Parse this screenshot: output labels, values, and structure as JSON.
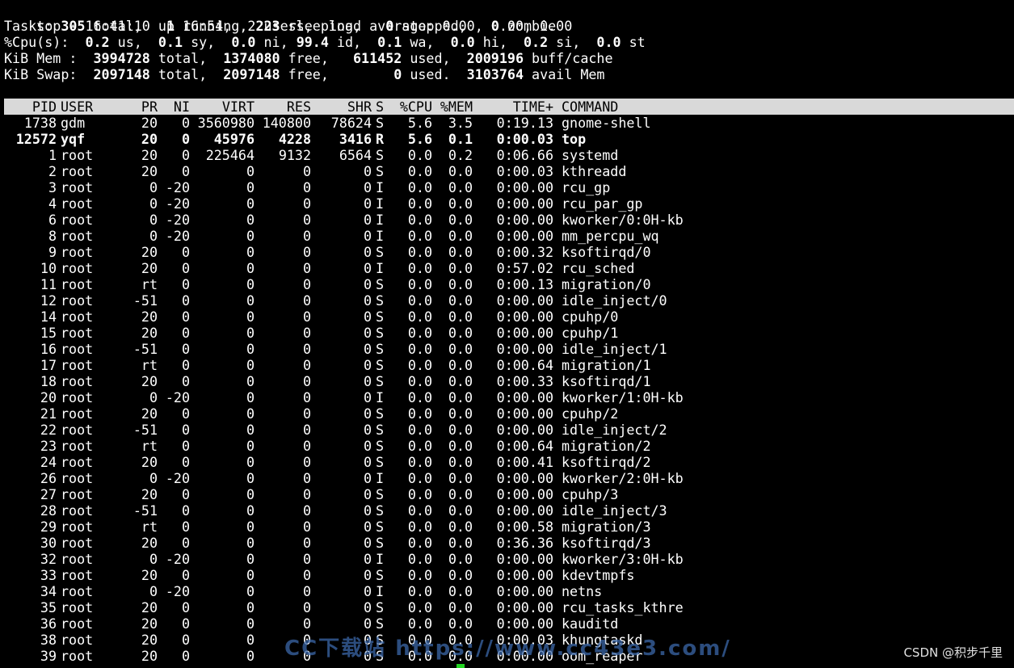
{
  "summary": {
    "line1": "top - 16:41:10 up 16:54,  2 users,  load average: 0.00, 0.00, 0.00",
    "tasks_label": "Tasks: ",
    "tasks_total": "305",
    "tasks_total_l": " total,   ",
    "tasks_running": "1",
    "tasks_running_l": " running, ",
    "tasks_sleeping": "223",
    "tasks_sleeping_l": " sleeping,   ",
    "tasks_stopped": "0",
    "tasks_stopped_l": " stopped,   ",
    "tasks_zombie": "0",
    "tasks_zombie_l": " zombie",
    "cpu_label": "%Cpu(s):  ",
    "cpu_us": "0.2",
    "cpu_us_l": " us,  ",
    "cpu_sy": "0.1",
    "cpu_sy_l": " sy,  ",
    "cpu_ni": "0.0",
    "cpu_ni_l": " ni, ",
    "cpu_id": "99.4",
    "cpu_id_l": " id,  ",
    "cpu_wa": "0.1",
    "cpu_wa_l": " wa,  ",
    "cpu_hi": "0.0",
    "cpu_hi_l": " hi,  ",
    "cpu_si": "0.2",
    "cpu_si_l": " si,  ",
    "cpu_st": "0.0",
    "cpu_st_l": " st",
    "mem_label": "KiB Mem :  ",
    "mem_total": "3994728",
    "mem_total_l": " total,  ",
    "mem_free": "1374080",
    "mem_free_l": " free,   ",
    "mem_used": "611452",
    "mem_used_l": " used,  ",
    "mem_buff": "2009196",
    "mem_buff_l": " buff/cache",
    "swap_label": "KiB Swap:  ",
    "swap_total": "2097148",
    "swap_total_l": " total,  ",
    "swap_free": "2097148",
    "swap_free_l": " free,        ",
    "swap_used": "0",
    "swap_used_l": " used.  ",
    "swap_avail": "3103764",
    "swap_avail_l": " avail Mem"
  },
  "columns": [
    "PID",
    "USER",
    "PR",
    "NI",
    "VIRT",
    "RES",
    "SHR",
    "S",
    "%CPU",
    "%MEM",
    "TIME+",
    "COMMAND"
  ],
  "processes": [
    {
      "pid": "1738",
      "user": "gdm",
      "pr": "20",
      "ni": "0",
      "virt": "3560980",
      "res": "140800",
      "shr": "78624",
      "s": "S",
      "cpu": "5.6",
      "mem": "3.5",
      "time": "0:19.13",
      "cmd": "gnome-shell",
      "bold": false
    },
    {
      "pid": "12572",
      "user": "yqf",
      "pr": "20",
      "ni": "0",
      "virt": "45976",
      "res": "4228",
      "shr": "3416",
      "s": "R",
      "cpu": "5.6",
      "mem": "0.1",
      "time": "0:00.03",
      "cmd": "top",
      "bold": true
    },
    {
      "pid": "1",
      "user": "root",
      "pr": "20",
      "ni": "0",
      "virt": "225464",
      "res": "9132",
      "shr": "6564",
      "s": "S",
      "cpu": "0.0",
      "mem": "0.2",
      "time": "0:06.66",
      "cmd": "systemd",
      "bold": false
    },
    {
      "pid": "2",
      "user": "root",
      "pr": "20",
      "ni": "0",
      "virt": "0",
      "res": "0",
      "shr": "0",
      "s": "S",
      "cpu": "0.0",
      "mem": "0.0",
      "time": "0:00.03",
      "cmd": "kthreadd",
      "bold": false
    },
    {
      "pid": "3",
      "user": "root",
      "pr": "0",
      "ni": "-20",
      "virt": "0",
      "res": "0",
      "shr": "0",
      "s": "I",
      "cpu": "0.0",
      "mem": "0.0",
      "time": "0:00.00",
      "cmd": "rcu_gp",
      "bold": false
    },
    {
      "pid": "4",
      "user": "root",
      "pr": "0",
      "ni": "-20",
      "virt": "0",
      "res": "0",
      "shr": "0",
      "s": "I",
      "cpu": "0.0",
      "mem": "0.0",
      "time": "0:00.00",
      "cmd": "rcu_par_gp",
      "bold": false
    },
    {
      "pid": "6",
      "user": "root",
      "pr": "0",
      "ni": "-20",
      "virt": "0",
      "res": "0",
      "shr": "0",
      "s": "I",
      "cpu": "0.0",
      "mem": "0.0",
      "time": "0:00.00",
      "cmd": "kworker/0:0H-kb",
      "bold": false
    },
    {
      "pid": "8",
      "user": "root",
      "pr": "0",
      "ni": "-20",
      "virt": "0",
      "res": "0",
      "shr": "0",
      "s": "I",
      "cpu": "0.0",
      "mem": "0.0",
      "time": "0:00.00",
      "cmd": "mm_percpu_wq",
      "bold": false
    },
    {
      "pid": "9",
      "user": "root",
      "pr": "20",
      "ni": "0",
      "virt": "0",
      "res": "0",
      "shr": "0",
      "s": "S",
      "cpu": "0.0",
      "mem": "0.0",
      "time": "0:00.32",
      "cmd": "ksoftirqd/0",
      "bold": false
    },
    {
      "pid": "10",
      "user": "root",
      "pr": "20",
      "ni": "0",
      "virt": "0",
      "res": "0",
      "shr": "0",
      "s": "I",
      "cpu": "0.0",
      "mem": "0.0",
      "time": "0:57.02",
      "cmd": "rcu_sched",
      "bold": false
    },
    {
      "pid": "11",
      "user": "root",
      "pr": "rt",
      "ni": "0",
      "virt": "0",
      "res": "0",
      "shr": "0",
      "s": "S",
      "cpu": "0.0",
      "mem": "0.0",
      "time": "0:00.13",
      "cmd": "migration/0",
      "bold": false
    },
    {
      "pid": "12",
      "user": "root",
      "pr": "-51",
      "ni": "0",
      "virt": "0",
      "res": "0",
      "shr": "0",
      "s": "S",
      "cpu": "0.0",
      "mem": "0.0",
      "time": "0:00.00",
      "cmd": "idle_inject/0",
      "bold": false
    },
    {
      "pid": "14",
      "user": "root",
      "pr": "20",
      "ni": "0",
      "virt": "0",
      "res": "0",
      "shr": "0",
      "s": "S",
      "cpu": "0.0",
      "mem": "0.0",
      "time": "0:00.00",
      "cmd": "cpuhp/0",
      "bold": false
    },
    {
      "pid": "15",
      "user": "root",
      "pr": "20",
      "ni": "0",
      "virt": "0",
      "res": "0",
      "shr": "0",
      "s": "S",
      "cpu": "0.0",
      "mem": "0.0",
      "time": "0:00.00",
      "cmd": "cpuhp/1",
      "bold": false
    },
    {
      "pid": "16",
      "user": "root",
      "pr": "-51",
      "ni": "0",
      "virt": "0",
      "res": "0",
      "shr": "0",
      "s": "S",
      "cpu": "0.0",
      "mem": "0.0",
      "time": "0:00.00",
      "cmd": "idle_inject/1",
      "bold": false
    },
    {
      "pid": "17",
      "user": "root",
      "pr": "rt",
      "ni": "0",
      "virt": "0",
      "res": "0",
      "shr": "0",
      "s": "S",
      "cpu": "0.0",
      "mem": "0.0",
      "time": "0:00.64",
      "cmd": "migration/1",
      "bold": false
    },
    {
      "pid": "18",
      "user": "root",
      "pr": "20",
      "ni": "0",
      "virt": "0",
      "res": "0",
      "shr": "0",
      "s": "S",
      "cpu": "0.0",
      "mem": "0.0",
      "time": "0:00.33",
      "cmd": "ksoftirqd/1",
      "bold": false
    },
    {
      "pid": "20",
      "user": "root",
      "pr": "0",
      "ni": "-20",
      "virt": "0",
      "res": "0",
      "shr": "0",
      "s": "I",
      "cpu": "0.0",
      "mem": "0.0",
      "time": "0:00.00",
      "cmd": "kworker/1:0H-kb",
      "bold": false
    },
    {
      "pid": "21",
      "user": "root",
      "pr": "20",
      "ni": "0",
      "virt": "0",
      "res": "0",
      "shr": "0",
      "s": "S",
      "cpu": "0.0",
      "mem": "0.0",
      "time": "0:00.00",
      "cmd": "cpuhp/2",
      "bold": false
    },
    {
      "pid": "22",
      "user": "root",
      "pr": "-51",
      "ni": "0",
      "virt": "0",
      "res": "0",
      "shr": "0",
      "s": "S",
      "cpu": "0.0",
      "mem": "0.0",
      "time": "0:00.00",
      "cmd": "idle_inject/2",
      "bold": false
    },
    {
      "pid": "23",
      "user": "root",
      "pr": "rt",
      "ni": "0",
      "virt": "0",
      "res": "0",
      "shr": "0",
      "s": "S",
      "cpu": "0.0",
      "mem": "0.0",
      "time": "0:00.64",
      "cmd": "migration/2",
      "bold": false
    },
    {
      "pid": "24",
      "user": "root",
      "pr": "20",
      "ni": "0",
      "virt": "0",
      "res": "0",
      "shr": "0",
      "s": "S",
      "cpu": "0.0",
      "mem": "0.0",
      "time": "0:00.41",
      "cmd": "ksoftirqd/2",
      "bold": false
    },
    {
      "pid": "26",
      "user": "root",
      "pr": "0",
      "ni": "-20",
      "virt": "0",
      "res": "0",
      "shr": "0",
      "s": "I",
      "cpu": "0.0",
      "mem": "0.0",
      "time": "0:00.00",
      "cmd": "kworker/2:0H-kb",
      "bold": false
    },
    {
      "pid": "27",
      "user": "root",
      "pr": "20",
      "ni": "0",
      "virt": "0",
      "res": "0",
      "shr": "0",
      "s": "S",
      "cpu": "0.0",
      "mem": "0.0",
      "time": "0:00.00",
      "cmd": "cpuhp/3",
      "bold": false
    },
    {
      "pid": "28",
      "user": "root",
      "pr": "-51",
      "ni": "0",
      "virt": "0",
      "res": "0",
      "shr": "0",
      "s": "S",
      "cpu": "0.0",
      "mem": "0.0",
      "time": "0:00.00",
      "cmd": "idle_inject/3",
      "bold": false
    },
    {
      "pid": "29",
      "user": "root",
      "pr": "rt",
      "ni": "0",
      "virt": "0",
      "res": "0",
      "shr": "0",
      "s": "S",
      "cpu": "0.0",
      "mem": "0.0",
      "time": "0:00.58",
      "cmd": "migration/3",
      "bold": false
    },
    {
      "pid": "30",
      "user": "root",
      "pr": "20",
      "ni": "0",
      "virt": "0",
      "res": "0",
      "shr": "0",
      "s": "S",
      "cpu": "0.0",
      "mem": "0.0",
      "time": "0:36.36",
      "cmd": "ksoftirqd/3",
      "bold": false
    },
    {
      "pid": "32",
      "user": "root",
      "pr": "0",
      "ni": "-20",
      "virt": "0",
      "res": "0",
      "shr": "0",
      "s": "I",
      "cpu": "0.0",
      "mem": "0.0",
      "time": "0:00.00",
      "cmd": "kworker/3:0H-kb",
      "bold": false
    },
    {
      "pid": "33",
      "user": "root",
      "pr": "20",
      "ni": "0",
      "virt": "0",
      "res": "0",
      "shr": "0",
      "s": "S",
      "cpu": "0.0",
      "mem": "0.0",
      "time": "0:00.00",
      "cmd": "kdevtmpfs",
      "bold": false
    },
    {
      "pid": "34",
      "user": "root",
      "pr": "0",
      "ni": "-20",
      "virt": "0",
      "res": "0",
      "shr": "0",
      "s": "I",
      "cpu": "0.0",
      "mem": "0.0",
      "time": "0:00.00",
      "cmd": "netns",
      "bold": false
    },
    {
      "pid": "35",
      "user": "root",
      "pr": "20",
      "ni": "0",
      "virt": "0",
      "res": "0",
      "shr": "0",
      "s": "S",
      "cpu": "0.0",
      "mem": "0.0",
      "time": "0:00.00",
      "cmd": "rcu_tasks_kthre",
      "bold": false
    },
    {
      "pid": "36",
      "user": "root",
      "pr": "20",
      "ni": "0",
      "virt": "0",
      "res": "0",
      "shr": "0",
      "s": "S",
      "cpu": "0.0",
      "mem": "0.0",
      "time": "0:00.00",
      "cmd": "kauditd",
      "bold": false
    },
    {
      "pid": "38",
      "user": "root",
      "pr": "20",
      "ni": "0",
      "virt": "0",
      "res": "0",
      "shr": "0",
      "s": "S",
      "cpu": "0.0",
      "mem": "0.0",
      "time": "0:00.03",
      "cmd": "khungtaskd",
      "bold": false
    },
    {
      "pid": "39",
      "user": "root",
      "pr": "20",
      "ni": "0",
      "virt": "0",
      "res": "0",
      "shr": "0",
      "s": "S",
      "cpu": "0.0",
      "mem": "0.0",
      "time": "0:00.00",
      "cmd": "oom_reaper",
      "bold": false
    }
  ],
  "watermarks": {
    "site": "CC下载站 https://www.cc43e3.com/",
    "csdn": "CSDN @积步千里"
  },
  "colors": {
    "background": "#000000",
    "foreground": "#ffffff",
    "header_bar": "#d9d9d9",
    "cursor": "#22d622",
    "watermark_site": "#3b67a8"
  }
}
